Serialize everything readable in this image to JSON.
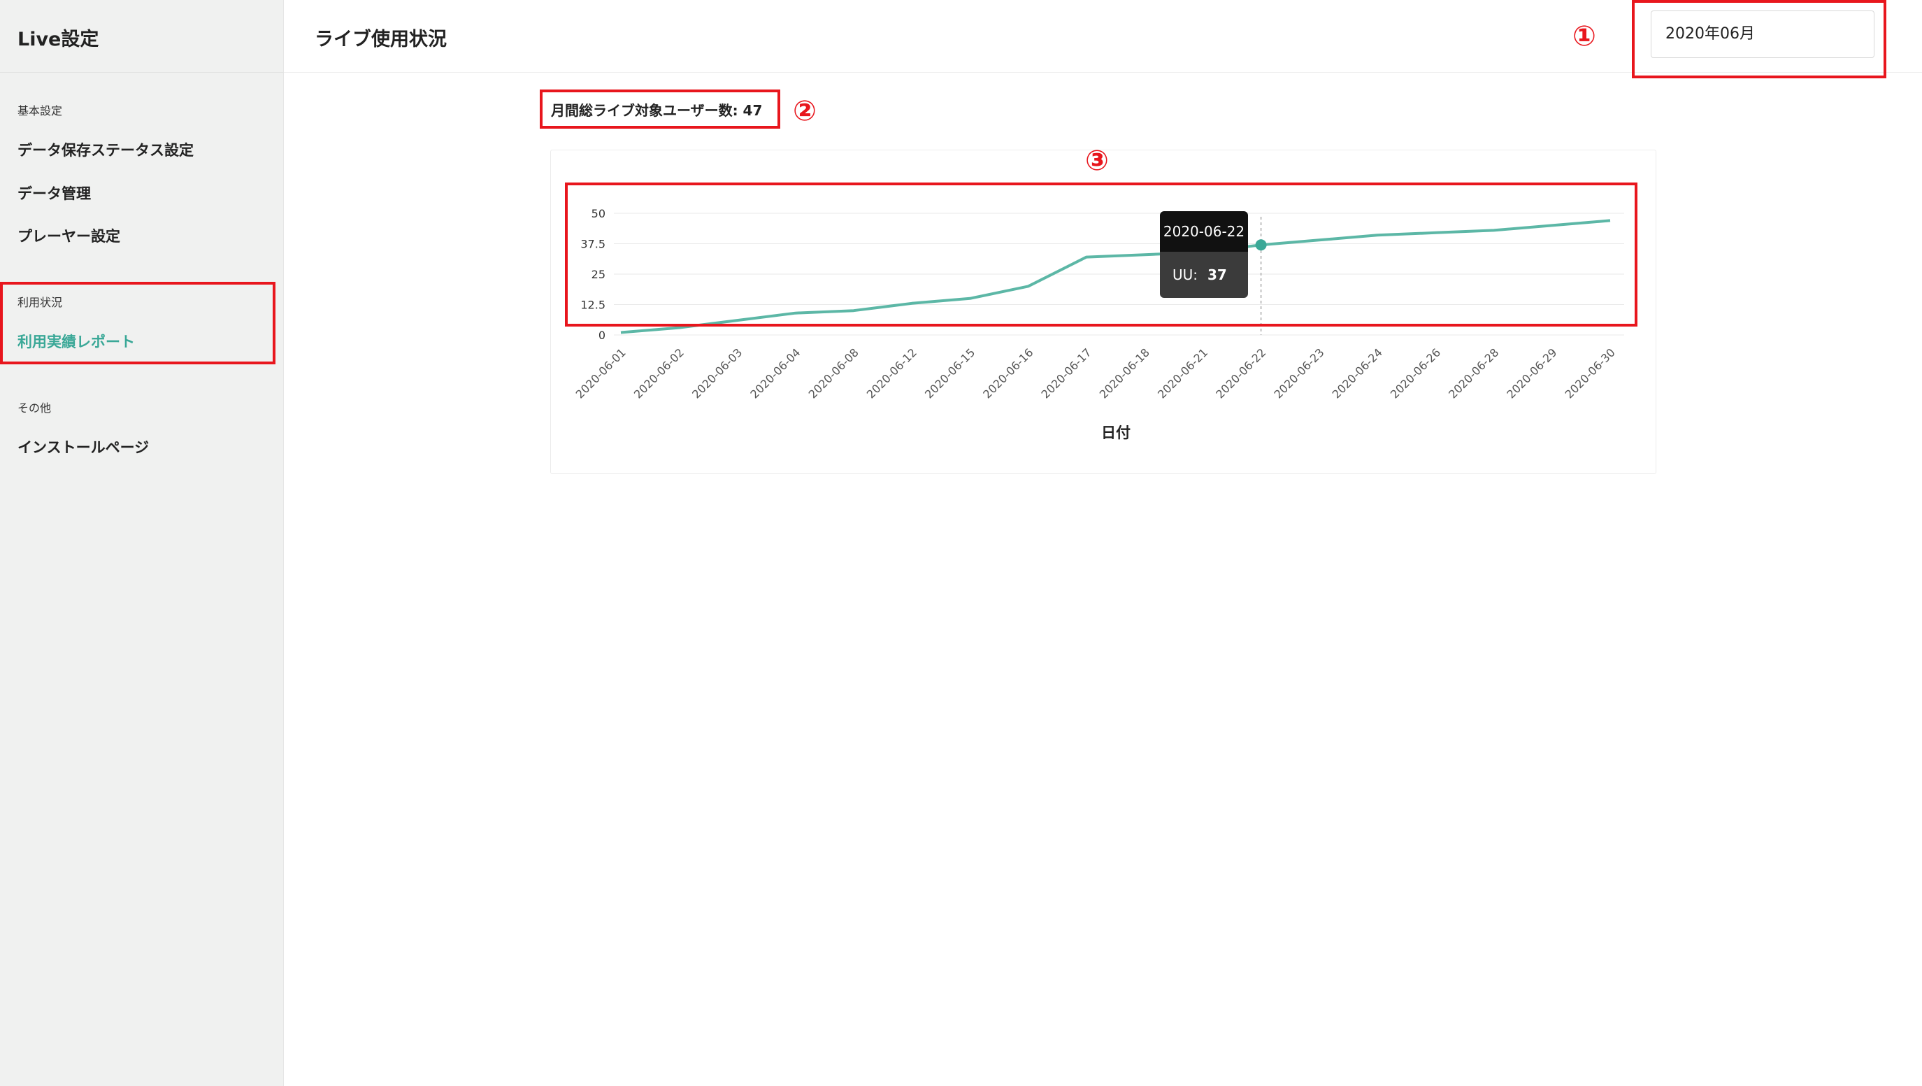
{
  "sidebar": {
    "app_title": "Live設定",
    "sections": [
      {
        "label": "基本設定",
        "items": [
          "データ保存ステータス設定",
          "データ管理",
          "プレーヤー設定"
        ]
      },
      {
        "label": "利用状況",
        "items": [
          "利用実績レポート"
        ]
      },
      {
        "label": "その他",
        "items": [
          "インストールページ"
        ]
      }
    ]
  },
  "header": {
    "page_title": "ライブ使用状況",
    "month_select": "2020年06月"
  },
  "annotations": [
    "①",
    "②",
    "③"
  ],
  "summary": {
    "total_users_label": "月間総ライブ対象ユーザー数: 47"
  },
  "tooltip": {
    "date": "2020-06-22",
    "metric": "UU:",
    "value": "37"
  },
  "colors": {
    "accent": "#3aa897",
    "line": "#5cb7a6",
    "annotation": "#e8161d"
  },
  "chart_data": {
    "type": "line",
    "xlabel": "日付",
    "ylabel": "",
    "ylim": [
      0,
      50
    ],
    "yticks": [
      "0",
      "12.5",
      "25",
      "37.5",
      "50"
    ],
    "x": [
      "2020-06-01",
      "2020-06-02",
      "2020-06-03",
      "2020-06-04",
      "2020-06-08",
      "2020-06-12",
      "2020-06-15",
      "2020-06-16",
      "2020-06-17",
      "2020-06-18",
      "2020-06-21",
      "2020-06-22",
      "2020-06-23",
      "2020-06-24",
      "2020-06-26",
      "2020-06-28",
      "2020-06-29",
      "2020-06-30"
    ],
    "series": [
      {
        "name": "UU",
        "values": [
          1,
          3,
          6,
          9,
          10,
          13,
          15,
          20,
          32,
          33,
          34,
          37,
          39,
          41,
          42,
          43,
          45,
          47
        ]
      }
    ],
    "grid": true,
    "legend": "none",
    "highlighted_x": "2020-06-22"
  }
}
